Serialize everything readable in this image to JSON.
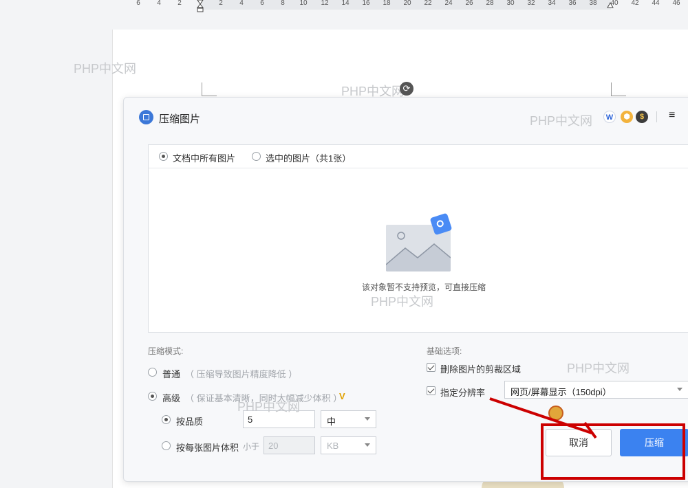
{
  "ruler": {
    "ticks": [
      "6",
      "4",
      "2",
      "2",
      "4",
      "6",
      "8",
      "10",
      "12",
      "14",
      "16",
      "18",
      "20",
      "22",
      "24",
      "26",
      "28",
      "30",
      "32",
      "34",
      "36",
      "38",
      "40",
      "42",
      "44",
      "46"
    ]
  },
  "watermark": "PHP中文网",
  "dialog": {
    "title": "压缩图片",
    "badges": {
      "wps": "W",
      "hex": "⬢",
      "coin": "$"
    },
    "menu_glyph": "≡",
    "scope": {
      "option_all": "文档中所有图片",
      "option_selected": "选中的图片（共1张）",
      "selected_value": "all"
    },
    "preview_message": "该对象暂不支持预览，可直接压缩",
    "mode": {
      "title": "压缩模式:",
      "normal_label": "普通",
      "normal_hint": "（ 压缩导致图片精度降低 ）",
      "advanced_label": "高级",
      "advanced_hint": "（ 保证基本清晰，同时大幅减少体积 ）",
      "vip_glyph": "V",
      "selected": "advanced",
      "by_quality_label": "按品质",
      "quality_value": "5",
      "quality_level": "中",
      "by_size_label": "按每张图片体积",
      "size_prefix": "小于",
      "size_value": "20",
      "size_unit": "KB",
      "sub_selected": "quality"
    },
    "basic": {
      "title": "基础选项:",
      "delete_crop_label": "删除图片的剪裁区域",
      "delete_crop_checked": true,
      "resolution_label": "指定分辨率",
      "resolution_checked": true,
      "resolution_value": "网页/屏幕显示（150dpi）"
    },
    "buttons": {
      "cancel": "取消",
      "compress": "压缩"
    }
  },
  "colors": {
    "primary": "#3b82f0",
    "annotation": "#cc0000"
  }
}
